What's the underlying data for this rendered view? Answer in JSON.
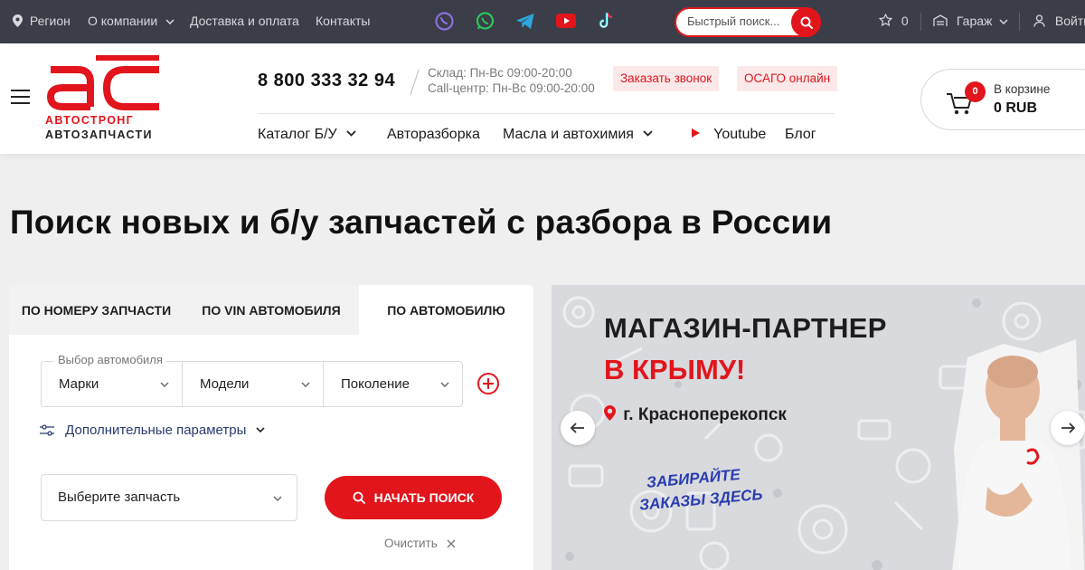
{
  "topbar": {
    "region": "Регион",
    "about": "О компании",
    "delivery": "Доставка и оплата",
    "contacts": "Контакты",
    "search_placeholder": "Быстрый поиск...",
    "favorites_count": "0",
    "garage": "Гараж",
    "login": "Войти",
    "social_icons": [
      "viber-icon",
      "whatsapp-icon",
      "telegram-icon",
      "youtube-icon",
      "tiktok-icon"
    ]
  },
  "header": {
    "logo_line1": "АВТОСТРОНГ",
    "logo_line2": "АВТОЗАПЧАСТИ",
    "phone": "8 800 333 32 94",
    "hours_warehouse": "Склад: Пн-Вс 09:00-20:00",
    "hours_callcenter": "Call-центр: Пн-Вс 09:00-20:00",
    "callback_btn": "Заказать звонок",
    "osago_btn": "ОСАГО онлайн",
    "nav": {
      "catalog": "Каталог Б/У",
      "razborka": "Авторазборка",
      "oils": "Масла и автохимия",
      "youtube": "Youtube",
      "blog": "Блог"
    },
    "cart": {
      "badge": "0",
      "label": "В корзине",
      "amount": "0 RUB"
    }
  },
  "main": {
    "title": "Поиск новых и б/у запчастей с разбора в России"
  },
  "search_panel": {
    "tabs": [
      "ПО НОМЕРУ ЗАПЧАСТИ",
      "ПО VIN АВТОМОБИЛЯ",
      "ПО АВТОМОБИЛЮ"
    ],
    "active_tab": "ПО АВТОМОБИЛЮ",
    "car_select_label": "Выбор автомобиля",
    "make": "Марки",
    "model": "Модели",
    "generation": "Поколение",
    "extra_params": "Дополнительные параметры",
    "part_select": "Выберите запчасть",
    "start_search": "НАЧАТЬ ПОИСК",
    "clear": "Очистить"
  },
  "banner": {
    "line1": "МАГАЗИН-ПАРТНЕР",
    "line2": "В КРЫМУ!",
    "location": "г. Красноперекопск",
    "pickup_line1": "ЗАБИРАЙТЕ",
    "pickup_line2": "ЗАКАЗЫ ЗДЕСЬ"
  },
  "colors": {
    "accent": "#e2151c",
    "topbar_bg": "#3b3e48",
    "page_bg": "#efefef",
    "link_blue": "#2a3b6c"
  }
}
